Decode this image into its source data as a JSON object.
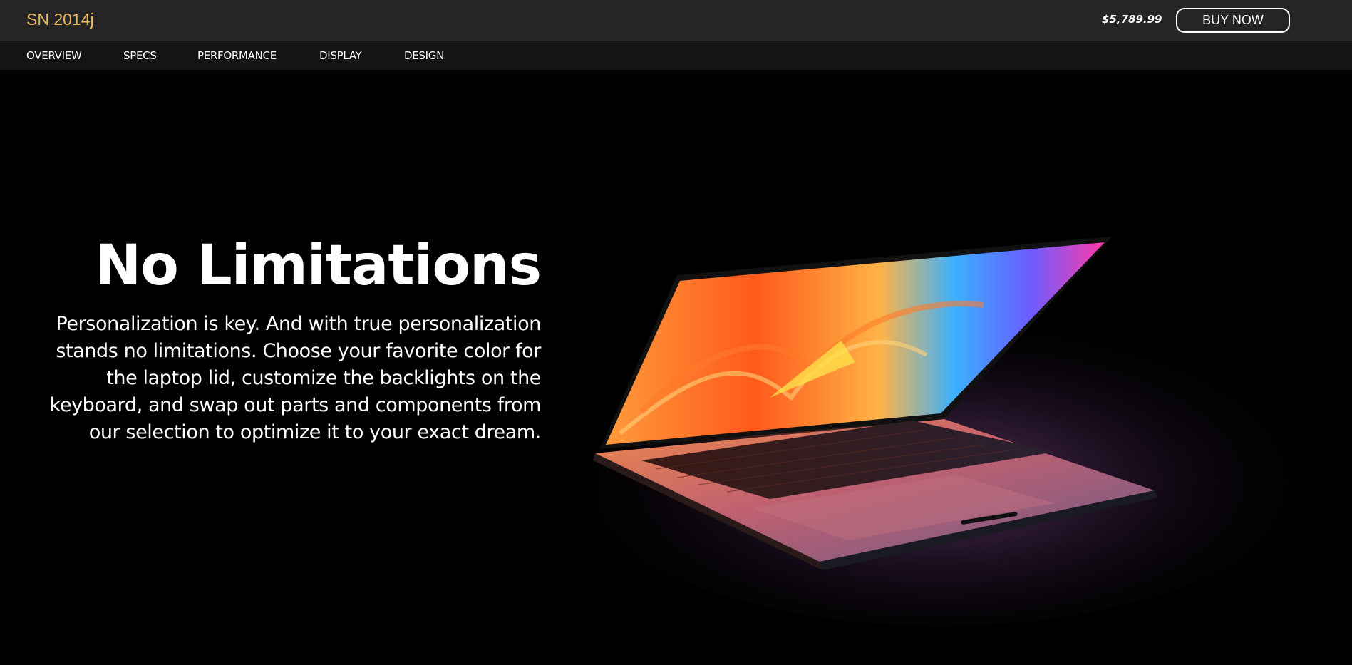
{
  "header": {
    "brand": "SN 2014j",
    "price": "$5,789.99",
    "buy_label": "BUY NOW"
  },
  "nav": {
    "items": [
      "OVERVIEW",
      "SPECS",
      "PERFORMANCE",
      "DISPLAY",
      "DESIGN"
    ]
  },
  "hero": {
    "title": "No Limitations",
    "body": "Personalization is key. And with true personalization stands no limitations. Choose your favorite color for the laptop lid, customize the backlights on the keyboard, and swap out parts and components from our selection to optimize it to your exact dream."
  },
  "colors": {
    "brand": "#e9b65a",
    "topbar": "#252525",
    "subnav": "#141414",
    "background": "#000000"
  }
}
